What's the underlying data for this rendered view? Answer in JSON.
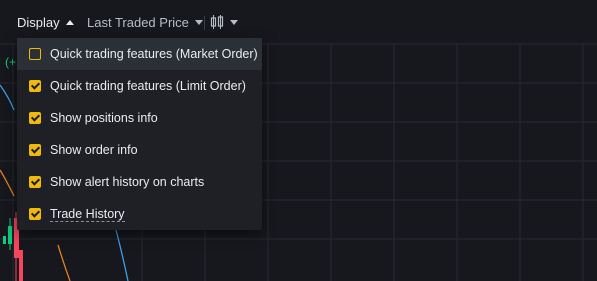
{
  "toolbar": {
    "display_label": "Display",
    "price_type_label": "Last Traded Price",
    "chart_type_icon": "candlestick-icon"
  },
  "chart_hint": "(+",
  "menu": {
    "items": [
      {
        "label": "Quick trading features (Market Order)",
        "checked": false,
        "highlighted": true
      },
      {
        "label": "Quick trading features (Limit Order)",
        "checked": true
      },
      {
        "label": "Show positions info",
        "checked": true
      },
      {
        "label": "Show order info",
        "checked": true
      },
      {
        "label": "Show alert history on charts",
        "checked": true
      },
      {
        "label": "Trade History",
        "checked": true,
        "dashed_underline": true
      }
    ]
  },
  "colors": {
    "accent": "#f0b90b",
    "background": "#16181d",
    "menu_background": "#1e2026",
    "grid": "#262a31",
    "up": "#0ecb81",
    "down": "#f6465d",
    "ma_blue": "#3c9ee5",
    "ma_orange": "#e5801c"
  }
}
